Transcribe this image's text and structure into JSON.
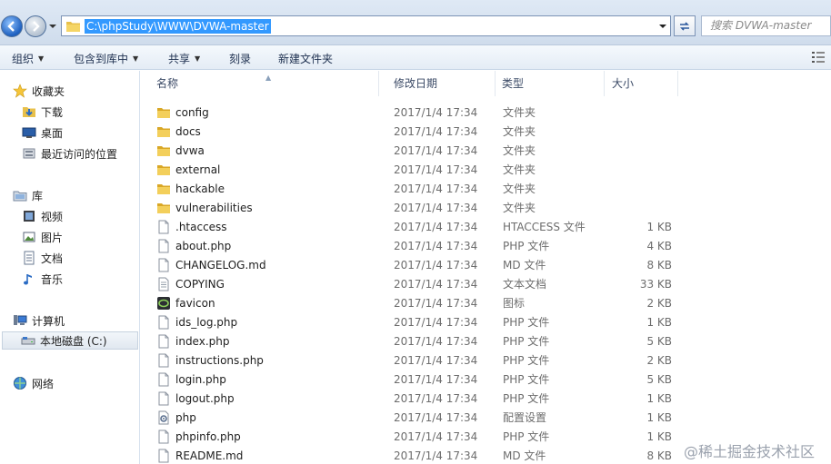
{
  "address": {
    "path": "C:\\phpStudy\\WWW\\DVWA-master",
    "search_placeholder": "搜索 DVWA-master"
  },
  "toolbar": {
    "organize": "组织",
    "include_library": "包含到库中",
    "share": "共享",
    "burn": "刻录",
    "new_folder": "新建文件夹"
  },
  "sidebar": {
    "favorites": "收藏夹",
    "downloads": "下载",
    "desktop": "桌面",
    "recent": "最近访问的位置",
    "libraries": "库",
    "videos": "视频",
    "pictures": "图片",
    "documents": "文档",
    "music": "音乐",
    "computer": "计算机",
    "local_disk": "本地磁盘 (C:)",
    "network": "网络"
  },
  "columns": {
    "name": "名称",
    "modified": "修改日期",
    "type": "类型",
    "size": "大小"
  },
  "files": [
    {
      "name": "config",
      "date": "2017/1/4 17:34",
      "type": "文件夹",
      "size": "",
      "icon": "folder-icon"
    },
    {
      "name": "docs",
      "date": "2017/1/4 17:34",
      "type": "文件夹",
      "size": "",
      "icon": "folder-icon"
    },
    {
      "name": "dvwa",
      "date": "2017/1/4 17:34",
      "type": "文件夹",
      "size": "",
      "icon": "folder-icon"
    },
    {
      "name": "external",
      "date": "2017/1/4 17:34",
      "type": "文件夹",
      "size": "",
      "icon": "folder-icon"
    },
    {
      "name": "hackable",
      "date": "2017/1/4 17:34",
      "type": "文件夹",
      "size": "",
      "icon": "folder-icon"
    },
    {
      "name": "vulnerabilities",
      "date": "2017/1/4 17:34",
      "type": "文件夹",
      "size": "",
      "icon": "folder-icon"
    },
    {
      "name": ".htaccess",
      "date": "2017/1/4 17:34",
      "type": "HTACCESS 文件",
      "size": "1 KB",
      "icon": "file-icon"
    },
    {
      "name": "about.php",
      "date": "2017/1/4 17:34",
      "type": "PHP 文件",
      "size": "4 KB",
      "icon": "file-icon"
    },
    {
      "name": "CHANGELOG.md",
      "date": "2017/1/4 17:34",
      "type": "MD 文件",
      "size": "8 KB",
      "icon": "file-icon"
    },
    {
      "name": "COPYING",
      "date": "2017/1/4 17:34",
      "type": "文本文档",
      "size": "33 KB",
      "icon": "text-file-icon"
    },
    {
      "name": "favicon",
      "date": "2017/1/4 17:34",
      "type": "图标",
      "size": "2 KB",
      "icon": "favicon-icon"
    },
    {
      "name": "ids_log.php",
      "date": "2017/1/4 17:34",
      "type": "PHP 文件",
      "size": "1 KB",
      "icon": "file-icon"
    },
    {
      "name": "index.php",
      "date": "2017/1/4 17:34",
      "type": "PHP 文件",
      "size": "5 KB",
      "icon": "file-icon"
    },
    {
      "name": "instructions.php",
      "date": "2017/1/4 17:34",
      "type": "PHP 文件",
      "size": "2 KB",
      "icon": "file-icon"
    },
    {
      "name": "login.php",
      "date": "2017/1/4 17:34",
      "type": "PHP 文件",
      "size": "5 KB",
      "icon": "file-icon"
    },
    {
      "name": "logout.php",
      "date": "2017/1/4 17:34",
      "type": "PHP 文件",
      "size": "1 KB",
      "icon": "file-icon"
    },
    {
      "name": "php",
      "date": "2017/1/4 17:34",
      "type": "配置设置",
      "size": "1 KB",
      "icon": "config-file-icon"
    },
    {
      "name": "phpinfo.php",
      "date": "2017/1/4 17:34",
      "type": "PHP 文件",
      "size": "1 KB",
      "icon": "file-icon"
    },
    {
      "name": "README.md",
      "date": "2017/1/4 17:34",
      "type": "MD 文件",
      "size": "8 KB",
      "icon": "file-icon"
    }
  ],
  "watermark": "@稀土掘金技术社区"
}
